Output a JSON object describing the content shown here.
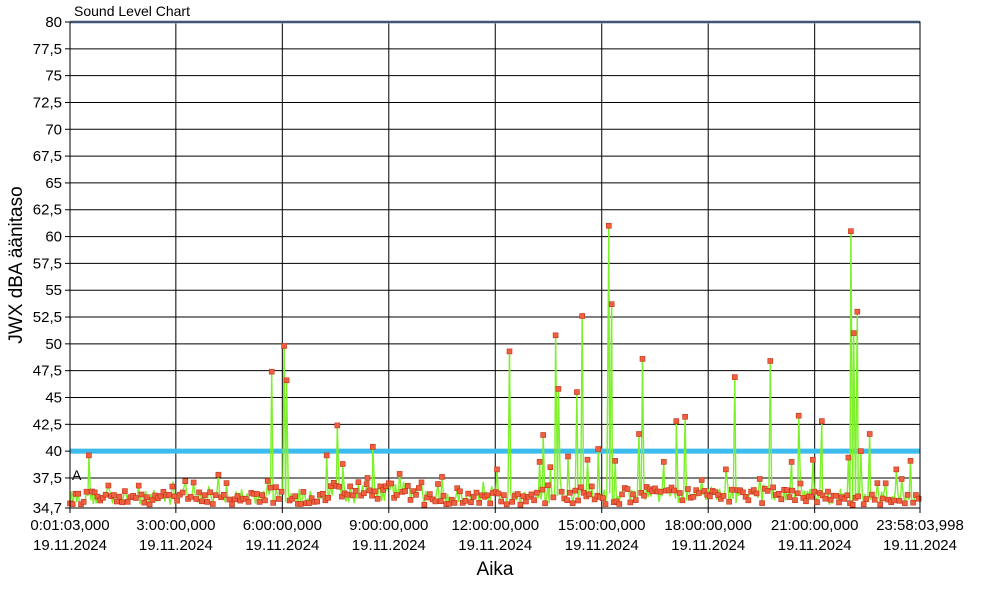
{
  "chart_data": {
    "type": "line",
    "title": "Sound Level Chart",
    "xlabel": "Aika",
    "ylabel": "JWX dBA äänitaso",
    "ylim": [
      34.7,
      80
    ],
    "y_ticks": [
      "34,7",
      "37,5",
      "40",
      "42,5",
      "45",
      "47,5",
      "50",
      "52,5",
      "55",
      "57,5",
      "60",
      "62,5",
      "65",
      "67,5",
      "70",
      "72,5",
      "75",
      "77,5",
      "80"
    ],
    "x_range_hours": [
      0.0175,
      23.9678
    ],
    "x_ticks": [
      {
        "time": "0:01:03,000",
        "date": "19.11.2024"
      },
      {
        "time": "3:00:00,000",
        "date": "19.11.2024"
      },
      {
        "time": "6:00:00,000",
        "date": "19.11.2024"
      },
      {
        "time": "9:00:00,000",
        "date": "19.11.2024"
      },
      {
        "time": "12:00:00,000",
        "date": "19.11.2024"
      },
      {
        "time": "15:00:00,000",
        "date": "19.11.2024"
      },
      {
        "time": "18:00:00,000",
        "date": "19.11.2024"
      },
      {
        "time": "21:00:00,000",
        "date": "19.11.2024"
      },
      {
        "time": "23:58:03,998",
        "date": "19.11.2024"
      }
    ],
    "grid": true,
    "reference_line": {
      "value": 40,
      "color": "#3bbcec"
    },
    "top_line": {
      "value": 80,
      "color": "#8ea8d2"
    },
    "series_line_color": "#7df02a",
    "marker_color": "#f06040",
    "marker_edge_color": "#c03418",
    "baseline_range": [
      35.0,
      36.3
    ],
    "corner_label": "A",
    "peaks": [
      {
        "x": 0.55,
        "y": 39.6
      },
      {
        "x": 1.1,
        "y": 36.8
      },
      {
        "x": 2.9,
        "y": 36.7
      },
      {
        "x": 4.2,
        "y": 37.8
      },
      {
        "x": 5.7,
        "y": 47.4
      },
      {
        "x": 6.05,
        "y": 49.8
      },
      {
        "x": 6.12,
        "y": 46.6
      },
      {
        "x": 7.25,
        "y": 39.6
      },
      {
        "x": 7.55,
        "y": 42.4
      },
      {
        "x": 7.7,
        "y": 38.8
      },
      {
        "x": 8.4,
        "y": 37.5
      },
      {
        "x": 8.55,
        "y": 40.4
      },
      {
        "x": 9.0,
        "y": 37.0
      },
      {
        "x": 10.5,
        "y": 37.6
      },
      {
        "x": 12.05,
        "y": 38.3
      },
      {
        "x": 12.4,
        "y": 49.3
      },
      {
        "x": 13.25,
        "y": 39.0
      },
      {
        "x": 13.35,
        "y": 41.5
      },
      {
        "x": 13.55,
        "y": 38.5
      },
      {
        "x": 13.7,
        "y": 50.8
      },
      {
        "x": 13.78,
        "y": 45.8
      },
      {
        "x": 14.05,
        "y": 39.5
      },
      {
        "x": 14.3,
        "y": 45.5
      },
      {
        "x": 14.45,
        "y": 52.6
      },
      {
        "x": 14.6,
        "y": 39.2
      },
      {
        "x": 14.9,
        "y": 40.2
      },
      {
        "x": 15.2,
        "y": 61.0
      },
      {
        "x": 15.28,
        "y": 53.7
      },
      {
        "x": 15.38,
        "y": 39.1
      },
      {
        "x": 16.05,
        "y": 41.6
      },
      {
        "x": 16.15,
        "y": 48.6
      },
      {
        "x": 16.75,
        "y": 39.0
      },
      {
        "x": 17.1,
        "y": 42.8
      },
      {
        "x": 17.35,
        "y": 43.2
      },
      {
        "x": 18.5,
        "y": 38.3
      },
      {
        "x": 18.75,
        "y": 46.9
      },
      {
        "x": 19.45,
        "y": 37.4
      },
      {
        "x": 19.75,
        "y": 48.4
      },
      {
        "x": 20.35,
        "y": 39.0
      },
      {
        "x": 20.55,
        "y": 43.3
      },
      {
        "x": 20.95,
        "y": 39.2
      },
      {
        "x": 21.2,
        "y": 42.8
      },
      {
        "x": 21.95,
        "y": 39.4
      },
      {
        "x": 22.02,
        "y": 60.5
      },
      {
        "x": 22.1,
        "y": 51.0
      },
      {
        "x": 22.2,
        "y": 53.0
      },
      {
        "x": 22.3,
        "y": 40.0
      },
      {
        "x": 22.55,
        "y": 41.6
      },
      {
        "x": 23.0,
        "y": 37.0
      },
      {
        "x": 23.3,
        "y": 38.3
      },
      {
        "x": 23.45,
        "y": 37.4
      },
      {
        "x": 23.7,
        "y": 39.1
      }
    ]
  }
}
